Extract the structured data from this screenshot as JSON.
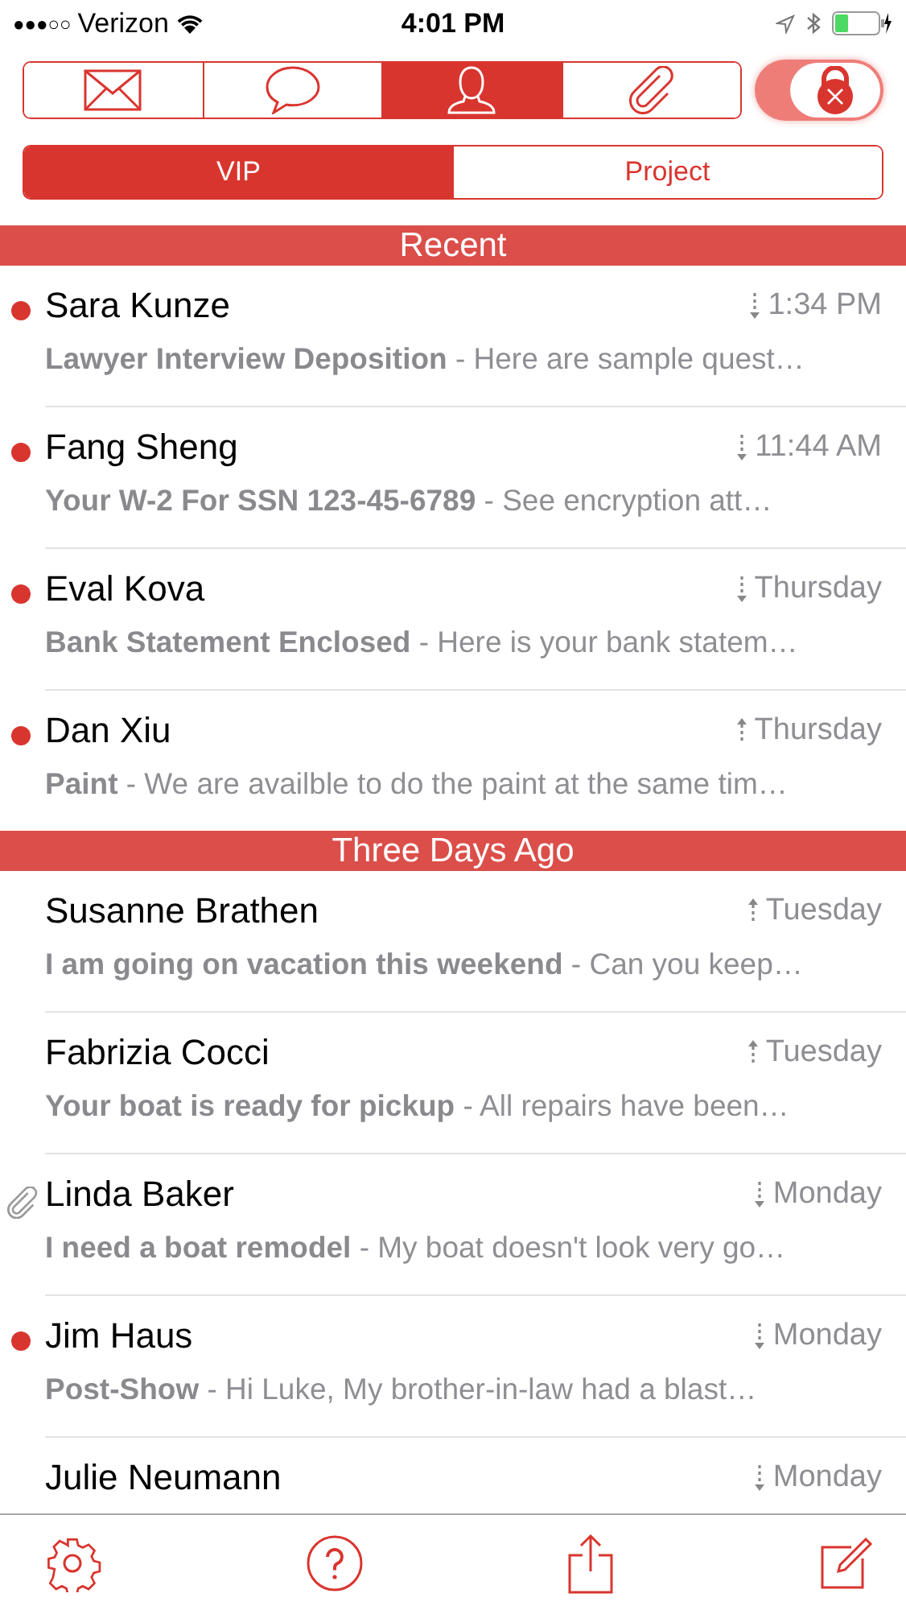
{
  "status_bar": {
    "signal": "●●●○○",
    "carrier": "Verizon",
    "time": "4:01 PM"
  },
  "tabs": [
    {
      "kind": "mail",
      "selected": false
    },
    {
      "kind": "chat",
      "selected": false
    },
    {
      "kind": "person",
      "selected": true
    },
    {
      "kind": "clip",
      "selected": false
    }
  ],
  "lock_toggle": {
    "on": true
  },
  "filters": [
    {
      "label": "VIP",
      "selected": true
    },
    {
      "label": "Project",
      "selected": false
    }
  ],
  "sections": [
    {
      "title": "Recent",
      "messages": [
        {
          "sender": "Sara Kunze",
          "time": "1:34 PM",
          "sent": false,
          "unread": true,
          "attachment": false,
          "subject": "Lawyer Interview Deposition",
          "preview": " - Here are sample quest…"
        },
        {
          "sender": "Fang Sheng",
          "time": "11:44 AM",
          "sent": false,
          "unread": true,
          "attachment": false,
          "subject": "Your W-2 For SSN 123-45-6789",
          "preview": " - See encryption att…"
        },
        {
          "sender": "Eval Kova",
          "time": "Thursday",
          "sent": false,
          "unread": true,
          "attachment": false,
          "subject": "Bank Statement Enclosed",
          "preview": " - Here is your bank statem…"
        },
        {
          "sender": "Dan Xiu",
          "time": "Thursday",
          "sent": true,
          "unread": true,
          "attachment": false,
          "subject": "Paint",
          "preview": " - We are availble to do the paint at the same tim…"
        }
      ]
    },
    {
      "title": "Three Days Ago",
      "messages": [
        {
          "sender": "Susanne Brathen",
          "time": "Tuesday",
          "sent": true,
          "unread": false,
          "attachment": false,
          "subject": "I am going on vacation this weekend",
          "preview": " - Can you keep…"
        },
        {
          "sender": "Fabrizia Cocci",
          "time": "Tuesday",
          "sent": true,
          "unread": false,
          "attachment": false,
          "subject": "Your boat is ready for pickup",
          "preview": " - All repairs have been…"
        },
        {
          "sender": "Linda Baker",
          "time": "Monday",
          "sent": false,
          "unread": false,
          "attachment": true,
          "subject": "I need a boat remodel",
          "preview": " - My boat doesn't look very go…"
        },
        {
          "sender": "Jim Haus",
          "time": "Monday",
          "sent": false,
          "unread": true,
          "attachment": false,
          "subject": "Post-Show",
          "preview": "  - Hi Luke, My brother-in-law had a blast…"
        },
        {
          "sender": "Julie Neumann",
          "time": "Monday",
          "sent": false,
          "unread": false,
          "attachment": false
        }
      ]
    }
  ],
  "toolbar": [
    {
      "kind": "settings"
    },
    {
      "kind": "help"
    },
    {
      "kind": "share"
    },
    {
      "kind": "compose"
    }
  ]
}
